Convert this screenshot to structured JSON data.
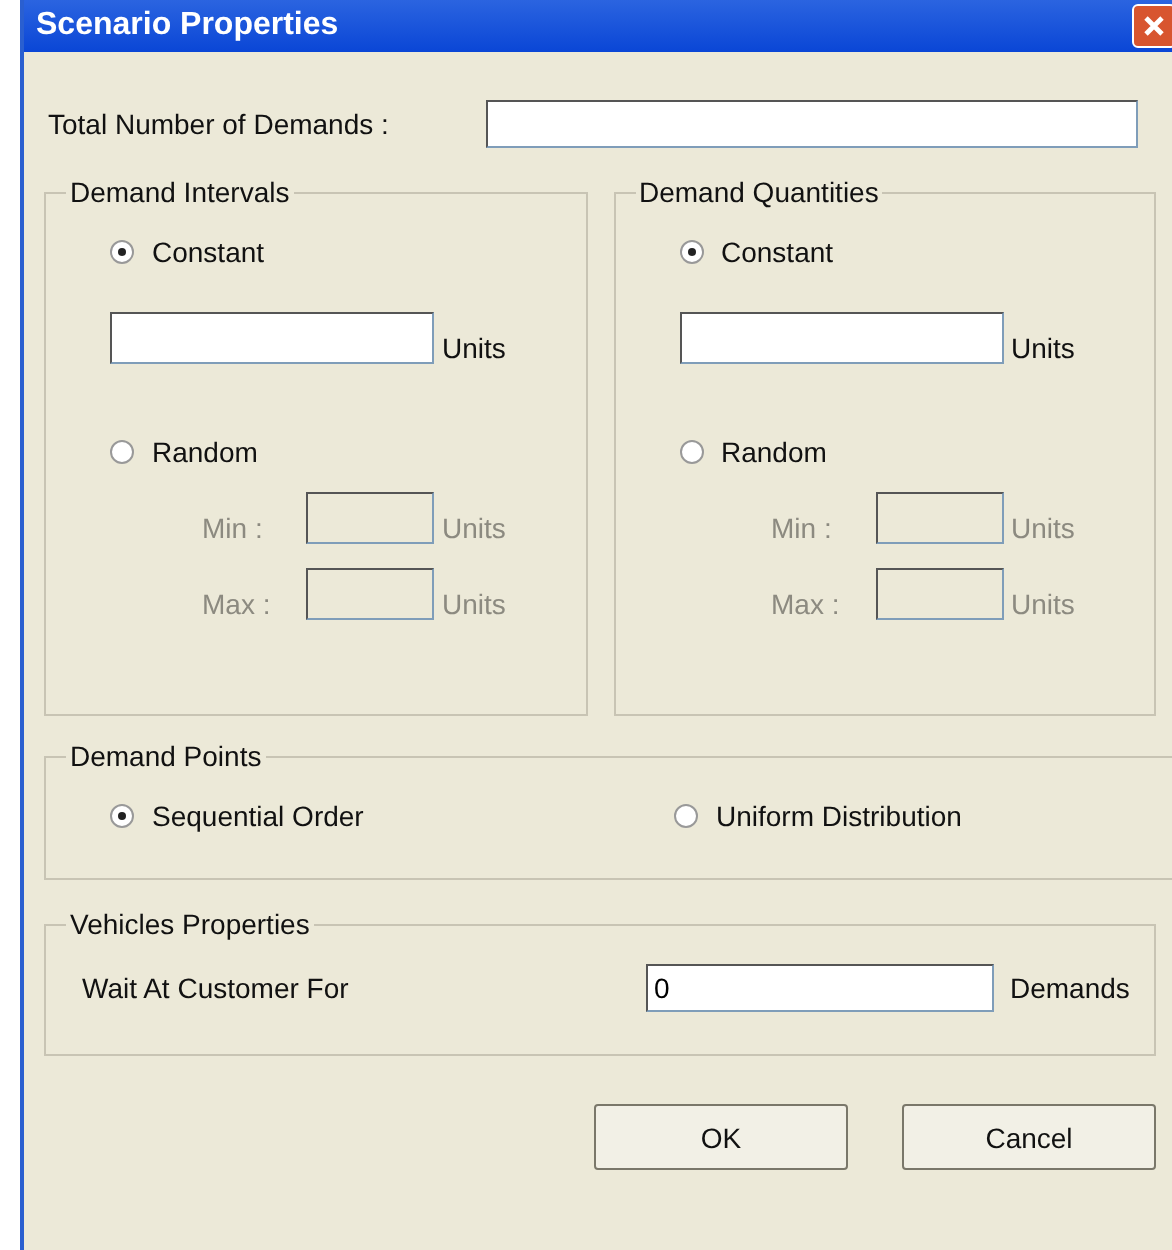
{
  "window": {
    "title": "Scenario Properties"
  },
  "total_demands": {
    "label": "Total Number of Demands :"
  },
  "panels": [
    {
      "title": "Demand Intervals",
      "constant": {
        "label": "Constant",
        "selected": true,
        "unit": "Units"
      },
      "random": {
        "label": "Random",
        "selected": false,
        "rows": [
          {
            "label": "Min :",
            "unit": "Units",
            "disabled": true
          },
          {
            "label": "Max :",
            "unit": "Units",
            "disabled": true
          }
        ]
      }
    },
    {
      "title": "Demand Quantities",
      "constant": {
        "label": "Constant",
        "selected": true,
        "unit": "Units"
      },
      "random": {
        "label": "Random",
        "selected": false,
        "rows": [
          {
            "label": "Min :",
            "unit": "Units",
            "disabled": true
          },
          {
            "label": "Max :",
            "unit": "Units",
            "disabled": true
          }
        ]
      }
    }
  ],
  "demand_points": {
    "title": "Demand Points",
    "options": [
      {
        "label": "Sequential Order",
        "selected": true
      },
      {
        "label": "Uniform Distribution",
        "selected": false
      }
    ]
  },
  "vehicles": {
    "title": "Vehicles Properties",
    "label": "Wait At Customer For",
    "value": "0",
    "unit": "Demands"
  },
  "buttons": [
    "OK",
    "Cancel"
  ]
}
